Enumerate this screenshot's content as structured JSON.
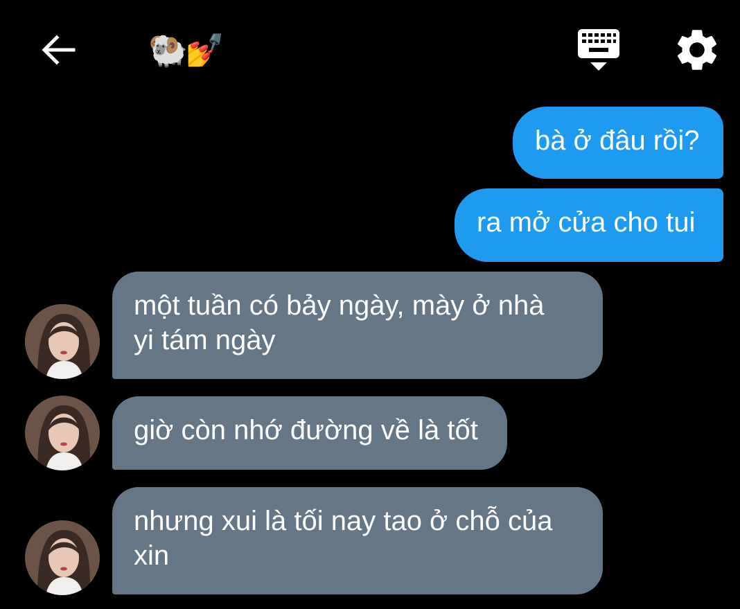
{
  "header": {
    "title_emoji": "🐏💅",
    "icons": {
      "back": "back-arrow-icon",
      "keyboard": "keyboard-icon",
      "settings": "gear-icon"
    }
  },
  "colors": {
    "background": "#000000",
    "outgoing_bubble": "#1e9bf0",
    "incoming_bubble": "#657786",
    "text": "#ffffff"
  },
  "messages": [
    {
      "direction": "outgoing",
      "lines": [
        "bà ở đâu rồi?"
      ]
    },
    {
      "direction": "outgoing",
      "lines": [
        "ra mở cửa cho tui"
      ]
    },
    {
      "direction": "incoming",
      "lines": [
        "một tuần có bảy ngày, mày ở nhà",
        "yi tám ngày"
      ]
    },
    {
      "direction": "incoming",
      "lines": [
        "giờ còn nhớ đường về là tốt"
      ]
    },
    {
      "direction": "incoming",
      "lines": [
        "nhưng xui là tối nay tao ở chỗ của",
        "xin"
      ]
    }
  ]
}
